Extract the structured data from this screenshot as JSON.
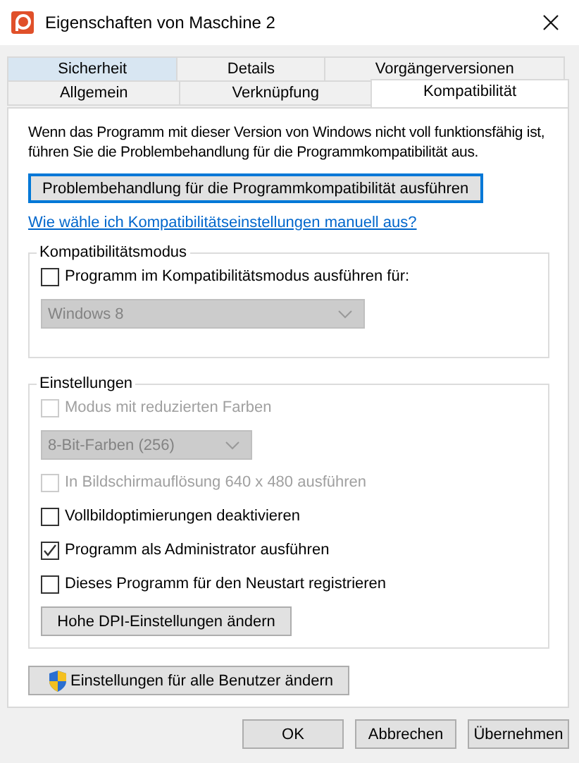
{
  "window": {
    "title": "Eigenschaften von Maschine 2"
  },
  "tab_rows": [
    [
      {
        "label": "Sicherheit",
        "selected": false,
        "hovered": true
      },
      {
        "label": "Details",
        "selected": false,
        "hovered": false
      },
      {
        "label": "Vorgängerversionen",
        "selected": false,
        "hovered": false
      }
    ],
    [
      {
        "label": "Allgemein",
        "selected": false,
        "hovered": false
      },
      {
        "label": "Verknüpfung",
        "selected": false,
        "hovered": false
      },
      {
        "label": "Kompatibilität",
        "selected": true,
        "hovered": false
      }
    ]
  ],
  "intro": "Wenn das Programm mit dieser Version von Windows nicht voll funktionsfähig ist, führen Sie die Problembehandlung für die Programmkompatibilität aus.",
  "troubleshoot_button": {
    "label": "Problembehandlung für die Programmkompatibilität ausführen",
    "focused": true
  },
  "manual_link": "Wie wähle ich Kompatibilitätseinstellungen manuell aus?",
  "compat_group": {
    "title": "Kompatibilitätsmodus",
    "items": [
      {
        "kind": "checkbox",
        "label": "Programm im Kompatibilitätsmodus ausführen für:",
        "checked": false,
        "disabled": false
      },
      {
        "kind": "dropdown",
        "value": "Windows 8",
        "disabled": true
      }
    ]
  },
  "settings_group": {
    "title": "Einstellungen",
    "items": [
      {
        "kind": "checkbox",
        "label": "Modus mit reduzierten Farben",
        "checked": false,
        "disabled": true
      },
      {
        "kind": "dropdown",
        "value": "8-Bit-Farben (256)",
        "disabled": true
      },
      {
        "kind": "checkbox",
        "label": "In Bildschirmauflösung 640 x 480 ausführen",
        "checked": false,
        "disabled": true
      },
      {
        "kind": "checkbox",
        "label": "Vollbildoptimierungen deaktivieren",
        "checked": false,
        "disabled": false
      },
      {
        "kind": "checkbox",
        "label": "Programm als Administrator ausführen",
        "checked": true,
        "disabled": false
      },
      {
        "kind": "checkbox",
        "label": "Dieses Programm für den Neustart registrieren",
        "checked": false,
        "disabled": false
      },
      {
        "kind": "button",
        "label": "Hohe DPI-Einstellungen ändern"
      }
    ]
  },
  "all_users_button": "Einstellungen für alle Benutzer ändern",
  "buttons": [
    "OK",
    "Abbrechen",
    "Übernehmen"
  ]
}
